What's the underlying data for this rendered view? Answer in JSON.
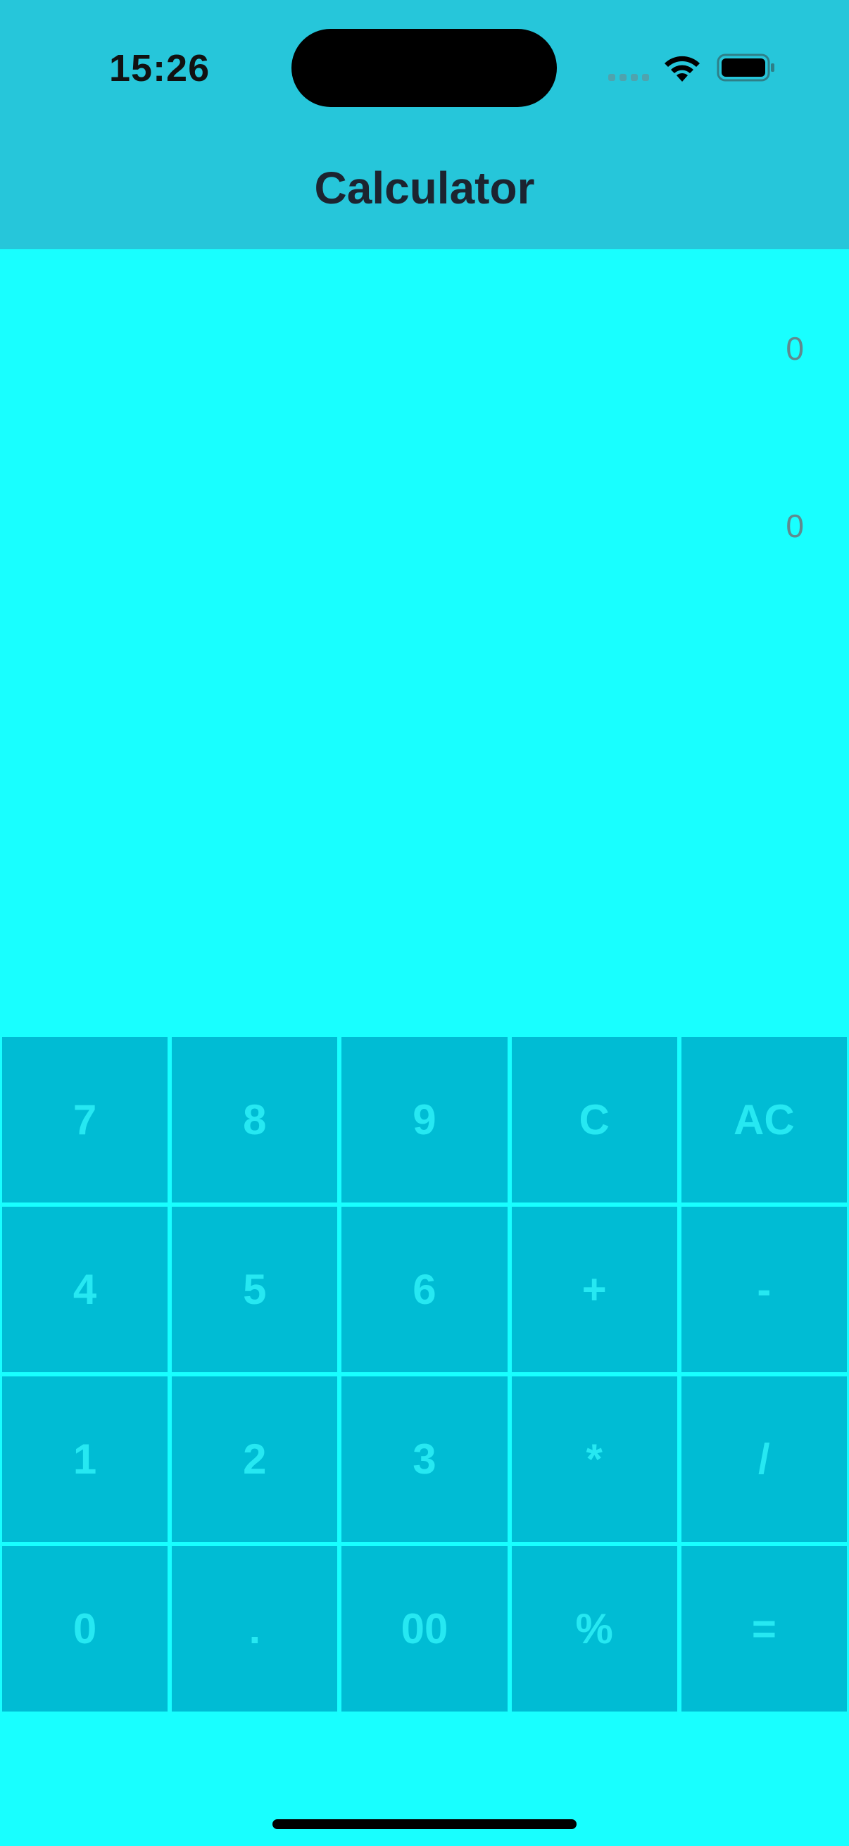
{
  "status_bar": {
    "time": "15:26"
  },
  "header": {
    "title": "Calculator"
  },
  "display": {
    "expression": "0",
    "result": "0"
  },
  "keypad": {
    "keys": [
      [
        "7",
        "8",
        "9",
        "C",
        "AC"
      ],
      [
        "4",
        "5",
        "6",
        "+",
        "-"
      ],
      [
        "1",
        "2",
        "3",
        "*",
        "/"
      ],
      [
        "0",
        ".",
        "00",
        "%",
        "="
      ]
    ]
  },
  "colors": {
    "background": "#18FFFF",
    "header_background": "#26C6DA",
    "key_background": "#00BCD4",
    "key_text": "#26E8F2",
    "title_text": "#1C2430",
    "display_text": "#5F8A8F"
  },
  "icons": {
    "cellular": "cellular-signal-icon",
    "wifi": "wifi-icon",
    "battery": "battery-icon"
  }
}
